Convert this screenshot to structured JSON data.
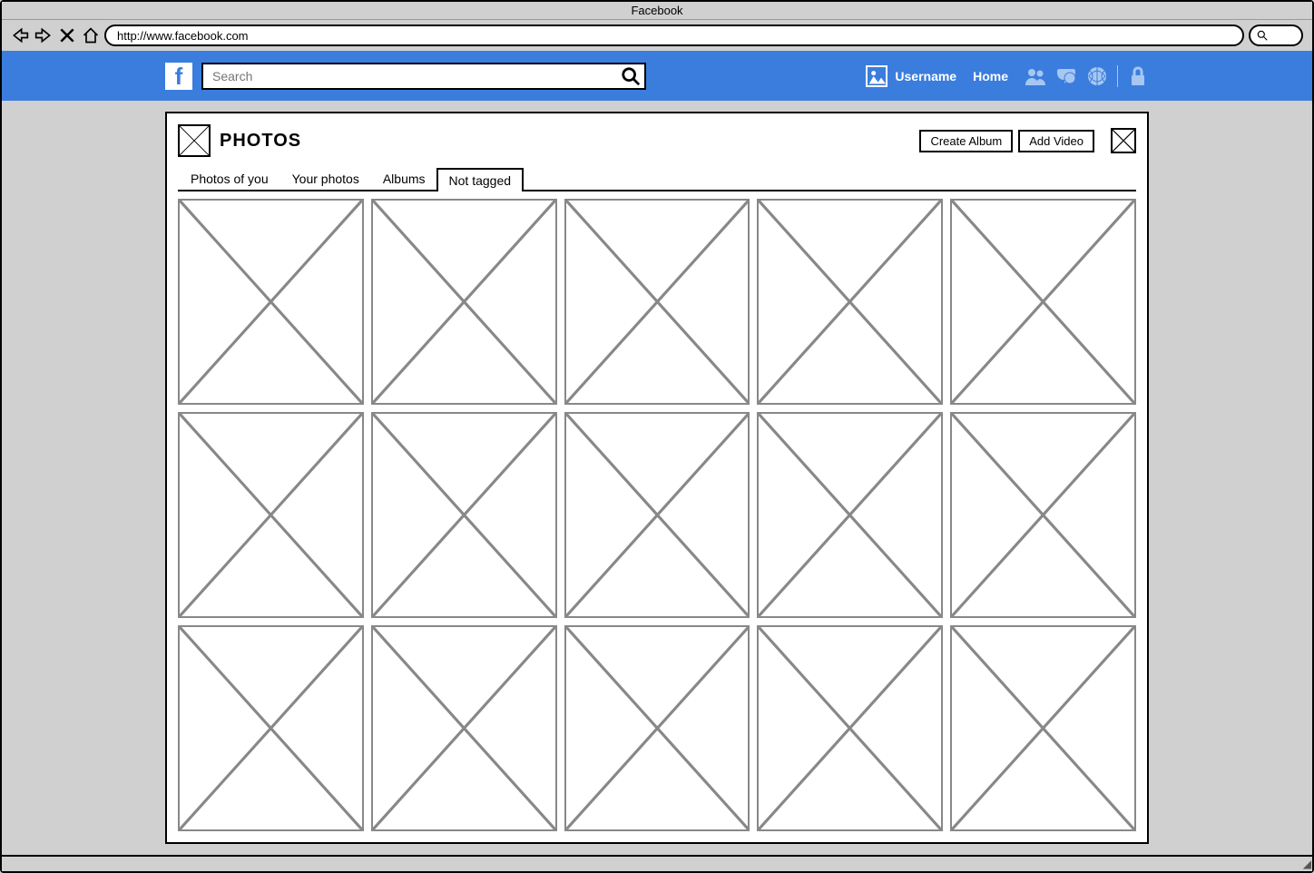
{
  "browser": {
    "title": "Facebook",
    "url": "http://www.facebook.com"
  },
  "header": {
    "search_placeholder": "Search",
    "username": "Username",
    "home": "Home"
  },
  "photos": {
    "title": "PHOTOS",
    "create_album": "Create Album",
    "add_video": "Add Video",
    "tabs": [
      {
        "label": "Photos of you"
      },
      {
        "label": "Your photos"
      },
      {
        "label": "Albums"
      },
      {
        "label": "Not tagged"
      }
    ]
  }
}
